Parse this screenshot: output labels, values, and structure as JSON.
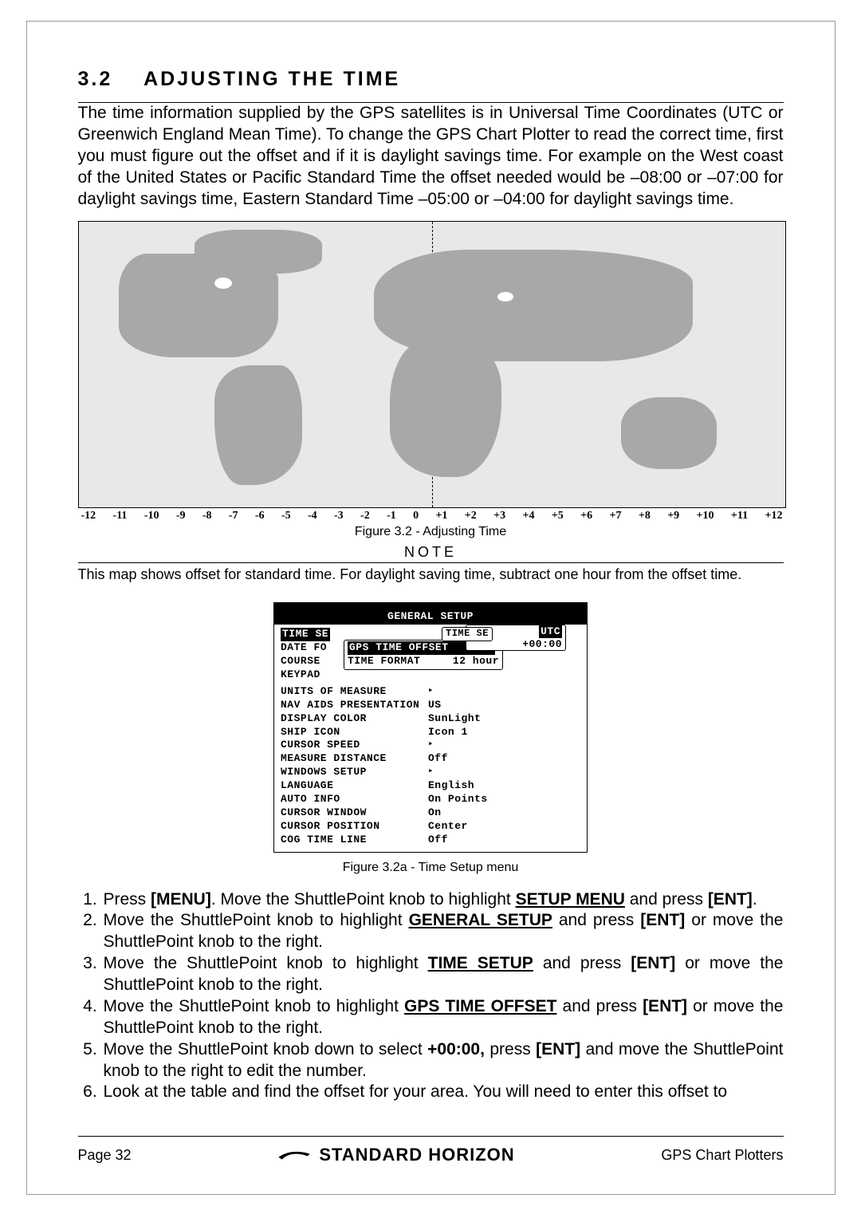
{
  "section_number": "3.2",
  "section_title": "ADJUSTING THE TIME",
  "intro_paragraph": "The time information supplied by the GPS satellites is in Universal Time Coordinates (UTC or Greenwich England Mean Time). To change the GPS Chart Plotter to read the correct time, first you must figure out the offset and if it is daylight savings time. For example on the West coast of the United States or Pacific Standard Time the offset needed would be –08:00 or –07:00 for daylight savings time, Eastern Standard Time –05:00 or –04:00 for daylight savings time.",
  "map_axis_labels": [
    "-12",
    "-11",
    "-10",
    "-9",
    "-8",
    "-7",
    "-6",
    "-5",
    "-4",
    "-3",
    "-2",
    "-1",
    "0",
    "+1",
    "+2",
    "+3",
    "+4",
    "+5",
    "+6",
    "+7",
    "+8",
    "+9",
    "+10",
    "+11",
    "+12"
  ],
  "figure1_caption": "Figure 3.2 - Adjusting Time",
  "note_label": "NOTE",
  "note_text": "This map shows offset for standard time. For daylight saving time, subtract one hour from the offset time.",
  "menu": {
    "title": "GENERAL SETUP",
    "left_labels": [
      "TIME SE",
      "DATE FO",
      "COURSE",
      "KEYPAD"
    ],
    "popup_time_se": "TIME SE",
    "popup_utc": "UTC",
    "popup_offset_value": "+00:00",
    "popup_gps_offset": "GPS TIME OFFSET",
    "popup_time_format": "TIME FORMAT",
    "popup_time_format_val": "12 hour",
    "rows": [
      {
        "k": "UNITS OF MEASURE",
        "v": "▸"
      },
      {
        "k": "NAV AIDS PRESENTATION",
        "v": "US"
      },
      {
        "k": "DISPLAY COLOR",
        "v": "SunLight"
      },
      {
        "k": "SHIP ICON",
        "v": "Icon 1"
      },
      {
        "k": "CURSOR SPEED",
        "v": "▸"
      },
      {
        "k": "MEASURE DISTANCE",
        "v": "Off"
      },
      {
        "k": "WINDOWS SETUP",
        "v": "▸"
      },
      {
        "k": "LANGUAGE",
        "v": "English"
      },
      {
        "k": "AUTO INFO",
        "v": "On Points"
      },
      {
        "k": "CURSOR WINDOW",
        "v": "On"
      },
      {
        "k": "CURSOR POSITION",
        "v": "Center"
      },
      {
        "k": "COG TIME LINE",
        "v": "Off"
      }
    ]
  },
  "figure2_caption": "Figure 3.2a - Time Setup menu",
  "steps": {
    "menu": "[MENU]",
    "setup_menu": "SETUP MENU",
    "ent": "[ENT]",
    "general_setup": "GENERAL SETUP",
    "time_setup": "TIME SETUP",
    "gps_time_offset": "GPS TIME OFFSET",
    "offset_value": "+00:00,",
    "s1a": "Press ",
    "s1b": ". Move the ShuttlePoint knob to highlight ",
    "s1c": " and press ",
    "s1d": ".",
    "s2a": "Move the ShuttlePoint knob to highlight ",
    "s2b": " and press ",
    "s2c": " or move the ShuttlePoint knob to the right.",
    "s3a": "Move the ShuttlePoint knob to highlight ",
    "s3b": " and press ",
    "s3c": " or move the ShuttlePoint knob to the right.",
    "s4a": "Move the ShuttlePoint knob to highlight ",
    "s4b": " and press ",
    "s4c": " or move the ShuttlePoint knob to the right.",
    "s5a": "Move the ShuttlePoint knob down to select ",
    "s5b": " press ",
    "s5c": " and move the ShuttlePoint knob to the right to edit the number.",
    "s6": "Look at the table and find the offset for your area. You will need to enter this offset to"
  },
  "footer": {
    "page_label": "Page 32",
    "brand": "STANDARD HORIZON",
    "right": "GPS Chart Plotters"
  }
}
